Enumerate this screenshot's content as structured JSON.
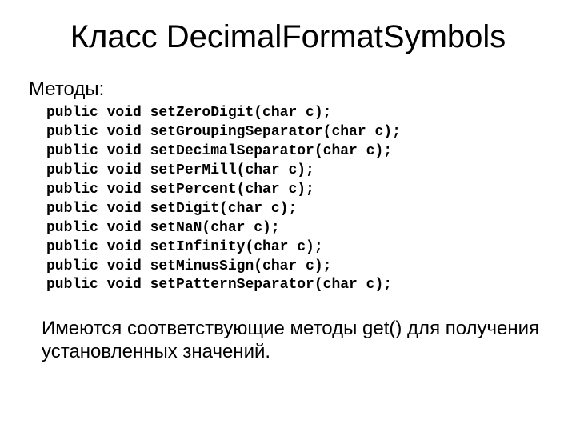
{
  "title": "Класс DecimalFormatSymbols",
  "subheading": "Методы:",
  "methods": [
    "public void setZeroDigit(char c);",
    "public void setGroupingSeparator(char c);",
    "public void setDecimalSeparator(char c);",
    "public void setPerMill(char c);",
    "public void setPercent(char c);",
    "public void setDigit(char c);",
    "public void setNaN(char c);",
    "public void setInfinity(char c);",
    "public void setMinusSign(char c);",
    "public void setPatternSeparator(char c);"
  ],
  "note": "Имеются соответствующие методы get() для получения установленных значений."
}
